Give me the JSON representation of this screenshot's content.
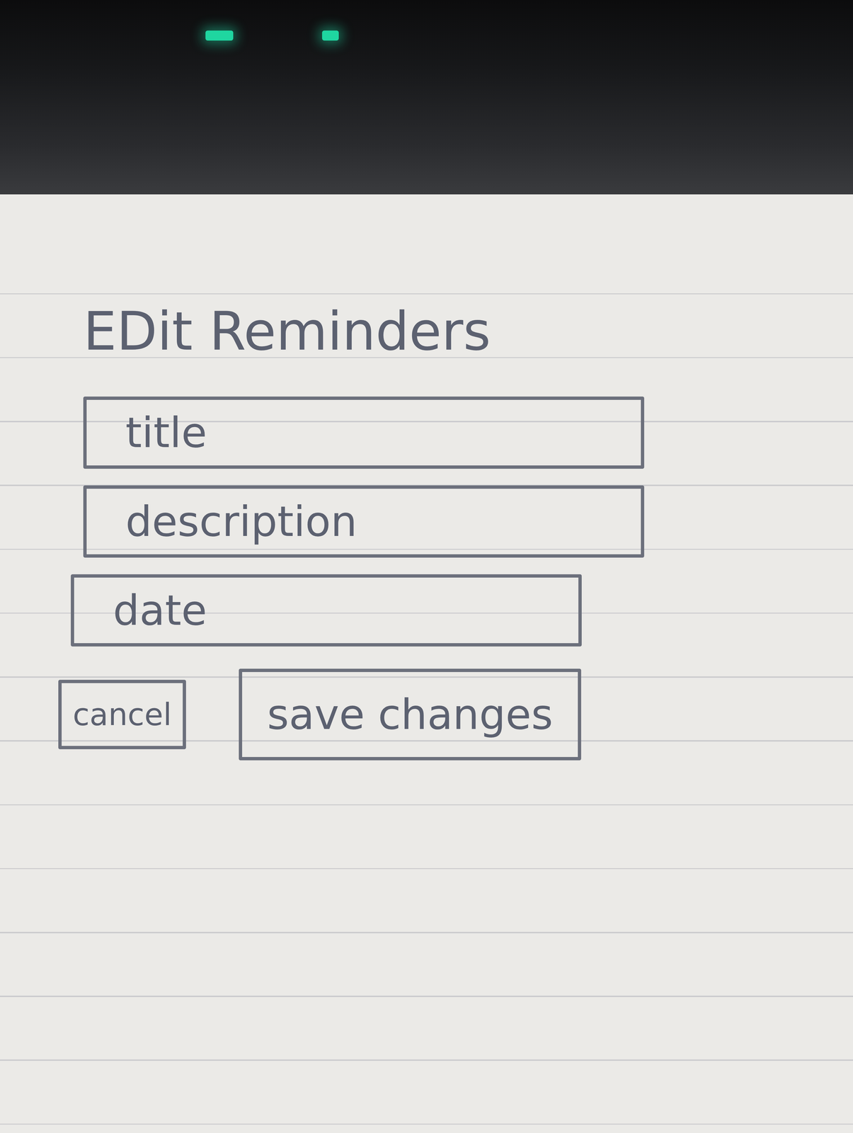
{
  "title": "EDit Reminders",
  "fields": [
    {
      "placeholder": "title"
    },
    {
      "placeholder": "description"
    },
    {
      "placeholder": "date"
    }
  ],
  "buttons": [
    {
      "label": "cancel",
      "kind": "secondary"
    },
    {
      "label": "save changes",
      "kind": "primary"
    }
  ]
}
